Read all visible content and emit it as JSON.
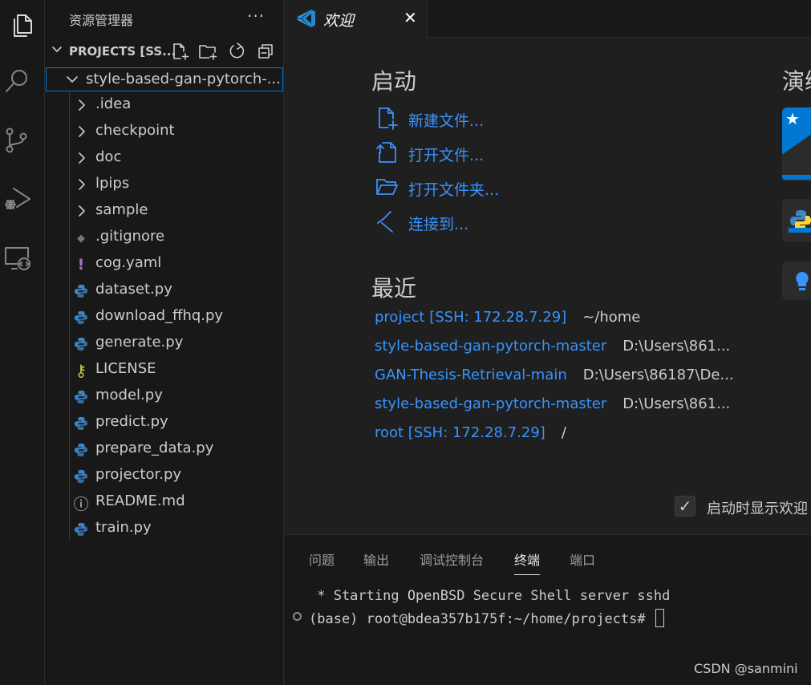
{
  "activity_bar": {
    "items": [
      {
        "icon": "files-icon",
        "active": true
      },
      {
        "icon": "search-icon"
      },
      {
        "icon": "source-control-icon"
      },
      {
        "icon": "run-debug-icon"
      },
      {
        "icon": "remote-explorer-icon"
      }
    ]
  },
  "sidebar": {
    "title": "资源管理器",
    "more": "···",
    "project_header": "PROJECTS [SS...",
    "root_folder": "style-based-gan-pytorch-...",
    "items": [
      {
        "label": ".idea",
        "type": "folder"
      },
      {
        "label": "checkpoint",
        "type": "folder"
      },
      {
        "label": "doc",
        "type": "folder"
      },
      {
        "label": "lpips",
        "type": "folder"
      },
      {
        "label": "sample",
        "type": "folder"
      },
      {
        "label": ".gitignore",
        "type": "git"
      },
      {
        "label": "cog.yaml",
        "type": "yaml"
      },
      {
        "label": "dataset.py",
        "type": "python"
      },
      {
        "label": "download_ffhq.py",
        "type": "python"
      },
      {
        "label": "generate.py",
        "type": "python"
      },
      {
        "label": "LICENSE",
        "type": "license"
      },
      {
        "label": "model.py",
        "type": "python"
      },
      {
        "label": "predict.py",
        "type": "python"
      },
      {
        "label": "prepare_data.py",
        "type": "python"
      },
      {
        "label": "projector.py",
        "type": "python"
      },
      {
        "label": "README.md",
        "type": "info"
      },
      {
        "label": "train.py",
        "type": "python"
      }
    ]
  },
  "editor": {
    "tab": {
      "label": "欢迎",
      "close": "✕"
    }
  },
  "welcome": {
    "start_heading": "启动",
    "start_items": [
      {
        "label": "新建文件...",
        "icon": "new-file-icon"
      },
      {
        "label": "打开文件...",
        "icon": "open-file-icon"
      },
      {
        "label": "打开文件夹...",
        "icon": "open-folder-icon"
      },
      {
        "label": "连接到...",
        "icon": "remote-connect-icon"
      }
    ],
    "recent_heading": "最近",
    "recent": [
      {
        "name": "project [SSH: 172.28.7.29]",
        "path": "~/home"
      },
      {
        "name": "style-based-gan-pytorch-master",
        "path": "D:\\Users\\861..."
      },
      {
        "name": "GAN-Thesis-Retrieval-main",
        "path": "D:\\Users\\86187\\De..."
      },
      {
        "name": "style-based-gan-pytorch-master",
        "path": "D:\\Users\\861..."
      },
      {
        "name": "root [SSH: 172.28.7.29]",
        "path": "/"
      }
    ],
    "walkthrough_heading": "演练",
    "show_on_startup_label": "启动时显示欢迎",
    "show_on_startup_checked": "✓"
  },
  "panel": {
    "tabs": [
      "问题",
      "输出",
      "调试控制台",
      "终端",
      "端口"
    ],
    "active_tab": "终端",
    "terminal": {
      "line1": " * Starting OpenBSD Secure Shell server sshd",
      "prompt": "(base) root@bdea357b175f:~/home/projects# "
    }
  },
  "watermark": "CSDN @sanmini",
  "colors": {
    "accent": "#3794ff",
    "focus_border": "#0078d4",
    "python_icon": "#3d85c6",
    "yaml_icon": "#a074c4",
    "license_icon": "#cbcb41"
  }
}
